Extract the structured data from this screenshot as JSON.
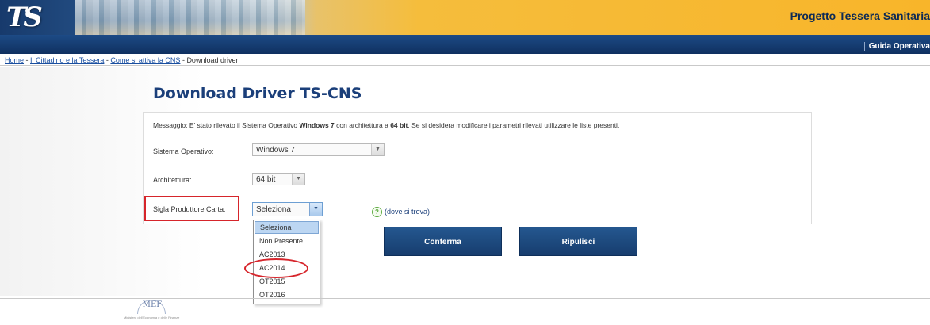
{
  "header": {
    "logo_text": "TS",
    "title": "Progetto Tessera Sanitaria",
    "nav_link": "Guida Operativa"
  },
  "breadcrumb": {
    "items": [
      "Home",
      "Il Cittadino e la Tessera",
      "Come si attiva la CNS"
    ],
    "separator": " - ",
    "current": "Download driver"
  },
  "page": {
    "title": "Download Driver TS-CNS",
    "message_prefix": "Messaggio: E' stato rilevato il Sistema Operativo ",
    "message_os": "Windows 7",
    "message_mid": " con architettura a ",
    "message_arch": "64 bit",
    "message_suffix": ". Se si desidera modificare i parametri rilevati utilizzare le liste presenti."
  },
  "form": {
    "os_label": "Sistema Operativo:",
    "os_value": "Windows 7",
    "arch_label": "Architettura:",
    "arch_value": "64 bit",
    "vendor_label": "Sigla Produttore Carta:",
    "vendor_value": "Seleziona",
    "help_text": "(dove si trova)",
    "vendor_options": [
      "Seleziona",
      "Non Presente",
      "AC2013",
      "AC2014",
      "OT2015",
      "OT2016"
    ],
    "vendor_selected_index": 0
  },
  "buttons": {
    "confirm": "Conferma",
    "reset": "Ripulisci"
  },
  "footer": {
    "logo_text": "MEF",
    "logo_sub": "Ministero dell'Economia e delle Finanze"
  },
  "colors": {
    "accent_red": "#d6252b",
    "title_blue": "#1b3f7a",
    "button_blue": "#173d6e"
  }
}
